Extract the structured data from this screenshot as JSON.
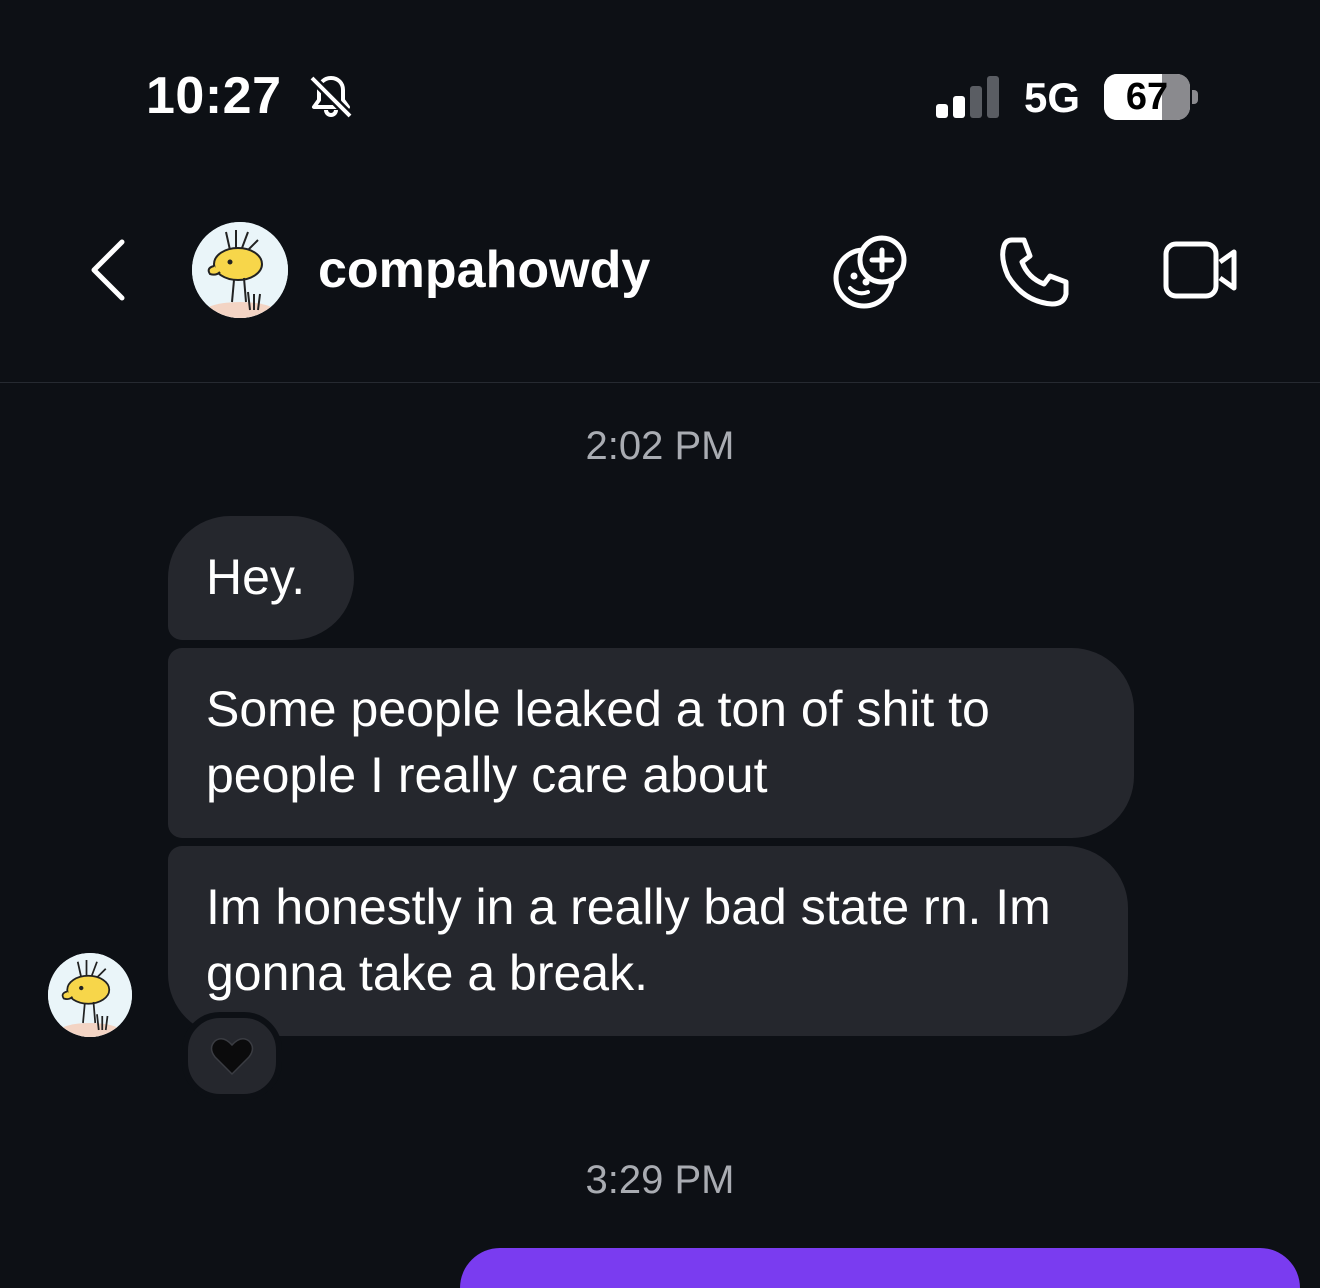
{
  "status_bar": {
    "time": "10:27",
    "network": "5G",
    "battery": "67",
    "battery_level": 0.67,
    "muted": true
  },
  "header": {
    "username": "compahowdy",
    "icons": [
      "back-chevron-icon",
      "add-friend-sticker-icon",
      "phone-icon",
      "video-camera-icon"
    ]
  },
  "chat": {
    "timestamps": [
      "2:02 PM",
      "3:29 PM"
    ],
    "messages": [
      {
        "text": "Hey."
      },
      {
        "text": "Some people leaked a ton of shit to people I really care about"
      },
      {
        "text": "Im honestly in a really bad state rn. Im gonna take a break."
      }
    ],
    "reaction": "black-heart"
  },
  "colors": {
    "background": "#0d1015",
    "bubble": "#25272d",
    "timestamp": "#a9acb2",
    "accent": "#7a3cf0"
  }
}
